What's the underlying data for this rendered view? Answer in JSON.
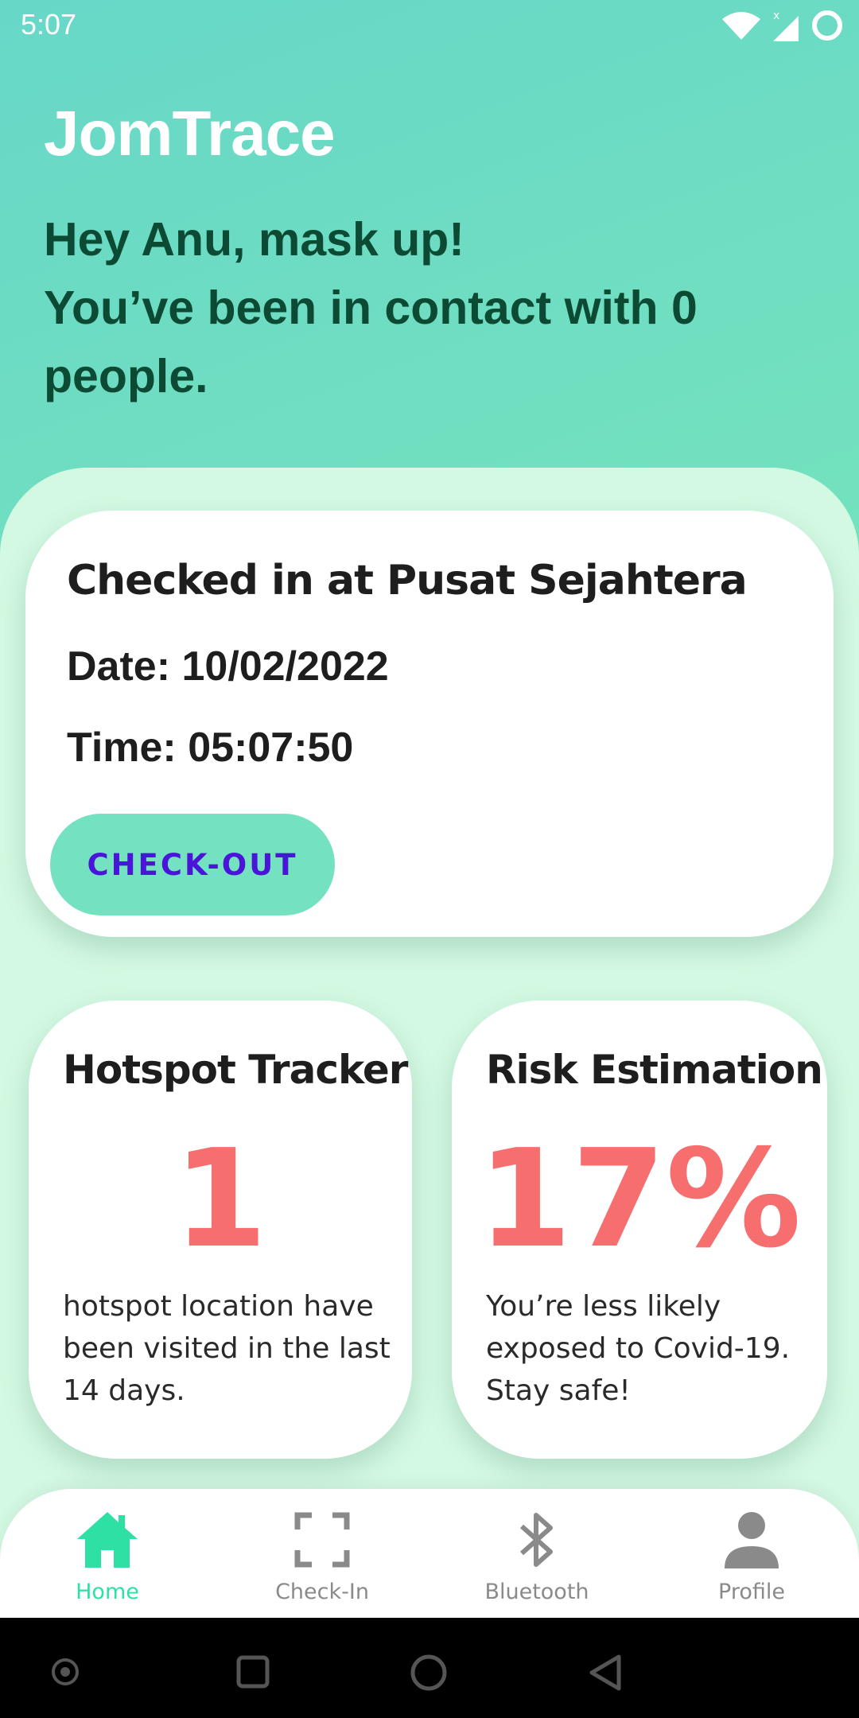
{
  "status_bar": {
    "time": "5:07",
    "icons": [
      "wifi-icon",
      "signal-icon",
      "battery-icon"
    ]
  },
  "app": {
    "title": "JomTrace",
    "greeting_line1": "Hey Anu, mask up!",
    "greeting_line2": "You’ve been in contact with 0 people."
  },
  "checkin": {
    "title": "Checked in at Pusat Sejahtera",
    "date": "Date: 10/02/2022",
    "time": "Time: 05:07:50",
    "checkout_label": "CHECK-OUT"
  },
  "hotspot": {
    "title": "Hotspot Tracker",
    "value": "1",
    "description": "hotspot location have been visited in the last 14 days."
  },
  "risk": {
    "title": "Risk Estimation",
    "value": "17%",
    "description": "You’re less likely exposed to Covid-19. Stay safe!"
  },
  "bottom_nav": {
    "items": [
      {
        "label": "Home",
        "icon": "home-icon",
        "active": true
      },
      {
        "label": "Check-In",
        "icon": "scan-icon",
        "active": false
      },
      {
        "label": "Bluetooth",
        "icon": "bluetooth-icon",
        "active": false
      },
      {
        "label": "Profile",
        "icon": "person-icon",
        "active": false
      }
    ]
  },
  "colors": {
    "accent": "#2fe0a4",
    "button": "#74e2c0",
    "button_text": "#4a14d9",
    "stat_value": "#f76e6f",
    "greeting": "#0d4a34"
  }
}
